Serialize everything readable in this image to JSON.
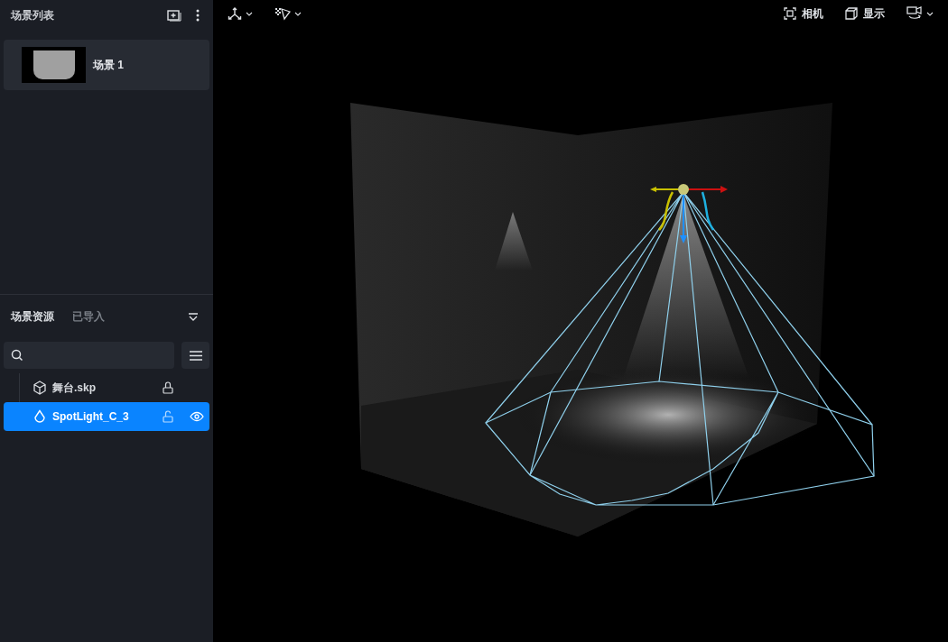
{
  "scene_list": {
    "title": "场景列表",
    "scenes": [
      {
        "name": "场景 1",
        "selected": true
      }
    ]
  },
  "resources": {
    "tabs": [
      {
        "label": "场景资源",
        "selected": true
      },
      {
        "label": "已导入",
        "selected": false
      }
    ],
    "tree": [
      {
        "kind": "model",
        "name": "舞台.skp",
        "selected": false,
        "locked": true
      },
      {
        "kind": "light",
        "name": "SpotLight_C_3",
        "selected": true,
        "locked": false
      }
    ]
  },
  "toolbar": {
    "right": [
      {
        "kind": "camera",
        "label": "相机"
      },
      {
        "kind": "display",
        "label": "显示"
      }
    ]
  }
}
